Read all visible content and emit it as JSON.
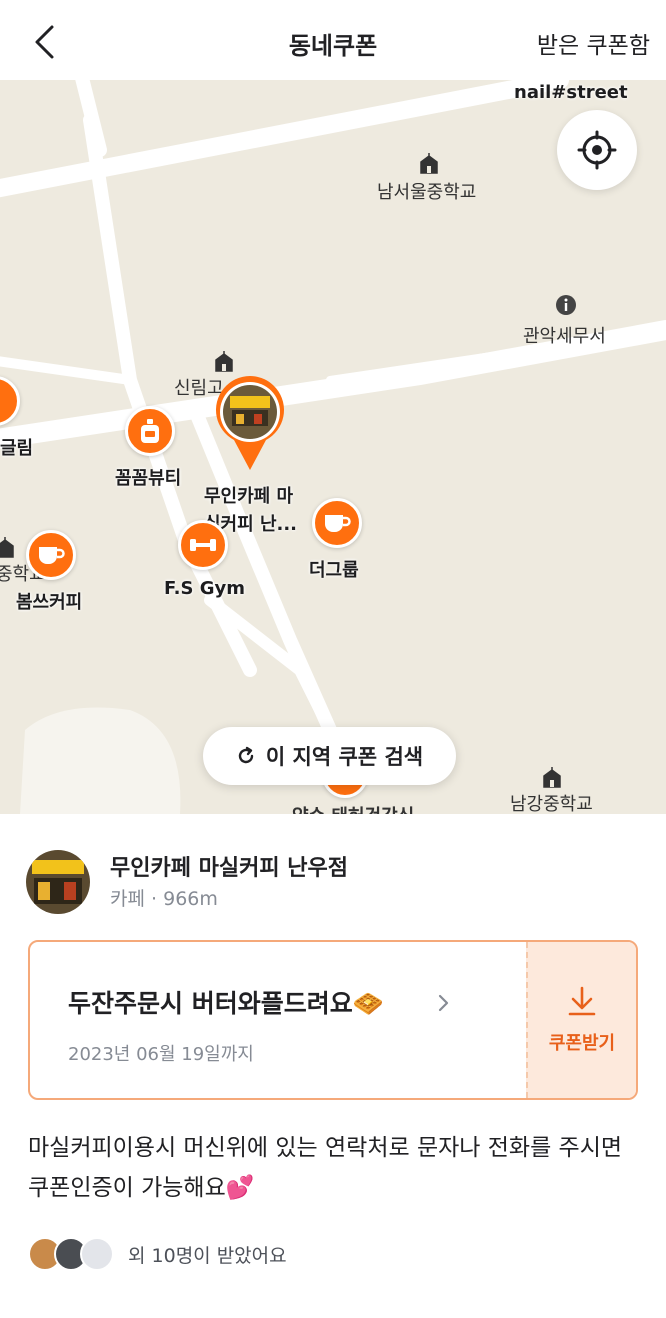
{
  "header": {
    "title": "동네쿠폰",
    "inbox_label": "받은 쿠폰함"
  },
  "map": {
    "labels": {
      "nail_street": "nail#street",
      "school_namseoul": "남서울중학교",
      "tax_office": "관악세무서",
      "school_sillim": "신림고",
      "glim": "글림",
      "school_middle_left": "중학교",
      "school_namgang": "남강중학교",
      "partial_bottom": "약수 태허건강식"
    },
    "pois": {
      "kkumkkum_beauty": "꼼꼼뷰티",
      "selected_store_line1": "무인카페 마",
      "selected_store_line2": "실커피 난...",
      "fs_gym": "F.S Gym",
      "the_group": "더그룹",
      "bomsseu_coffee": "봄쓰커피"
    },
    "search_area_label": "이 지역 쿠폰 검색"
  },
  "store": {
    "name": "무인카페 마실커피 난우점",
    "category": "카페",
    "distance": "966m"
  },
  "coupon": {
    "title": "두잔주문시 버터와플드려요🧇",
    "expiry": "2023년 06월 19일까지",
    "get_label": "쿠폰받기"
  },
  "description": "마실커피이용시 머신위에 있는 연락처로 문자나 전화를 주시면 쿠폰인증이 가능해요💕",
  "receivers": {
    "text": "외 10명이 받았어요"
  },
  "colors": {
    "accent": "#ff6f0f",
    "map_bg": "#eeeadf",
    "coupon_bg": "#fde9dc"
  }
}
